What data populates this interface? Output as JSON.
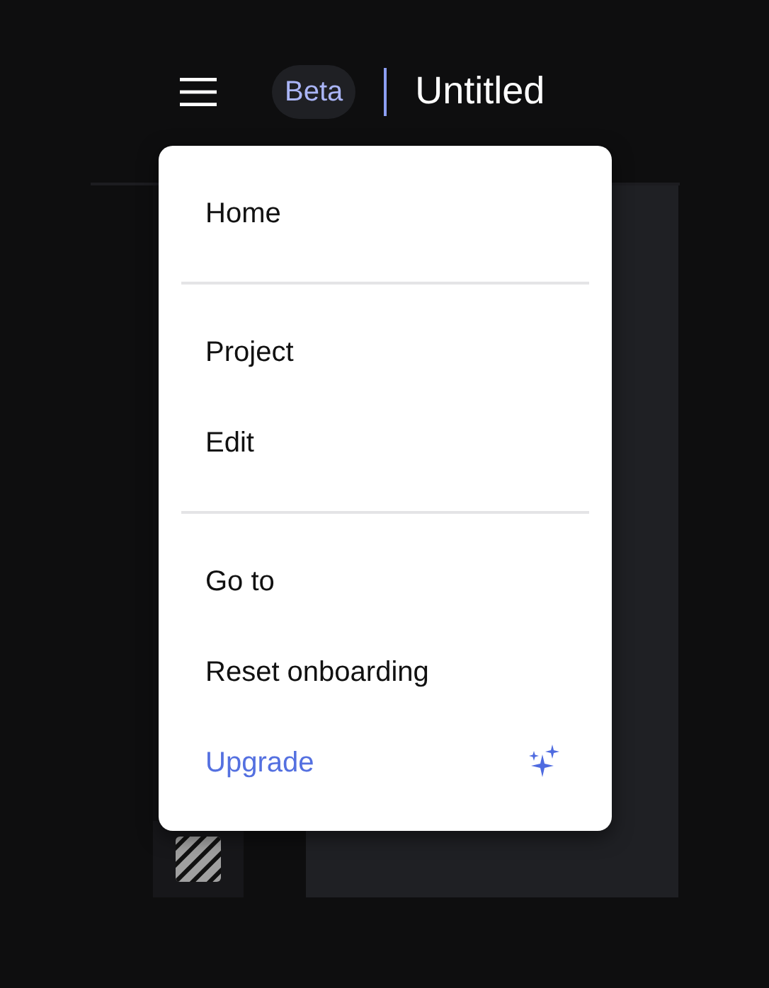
{
  "header": {
    "badge": "Beta",
    "title": "Untitled"
  },
  "menu": {
    "sections": [
      {
        "items": [
          {
            "label": "Home",
            "kind": "plain"
          }
        ]
      },
      {
        "items": [
          {
            "label": "Project",
            "kind": "plain"
          },
          {
            "label": "Edit",
            "kind": "plain"
          }
        ]
      },
      {
        "items": [
          {
            "label": "Go to",
            "kind": "plain"
          },
          {
            "label": "Reset onboarding",
            "kind": "plain"
          },
          {
            "label": "Upgrade",
            "kind": "upgrade"
          }
        ]
      }
    ]
  }
}
